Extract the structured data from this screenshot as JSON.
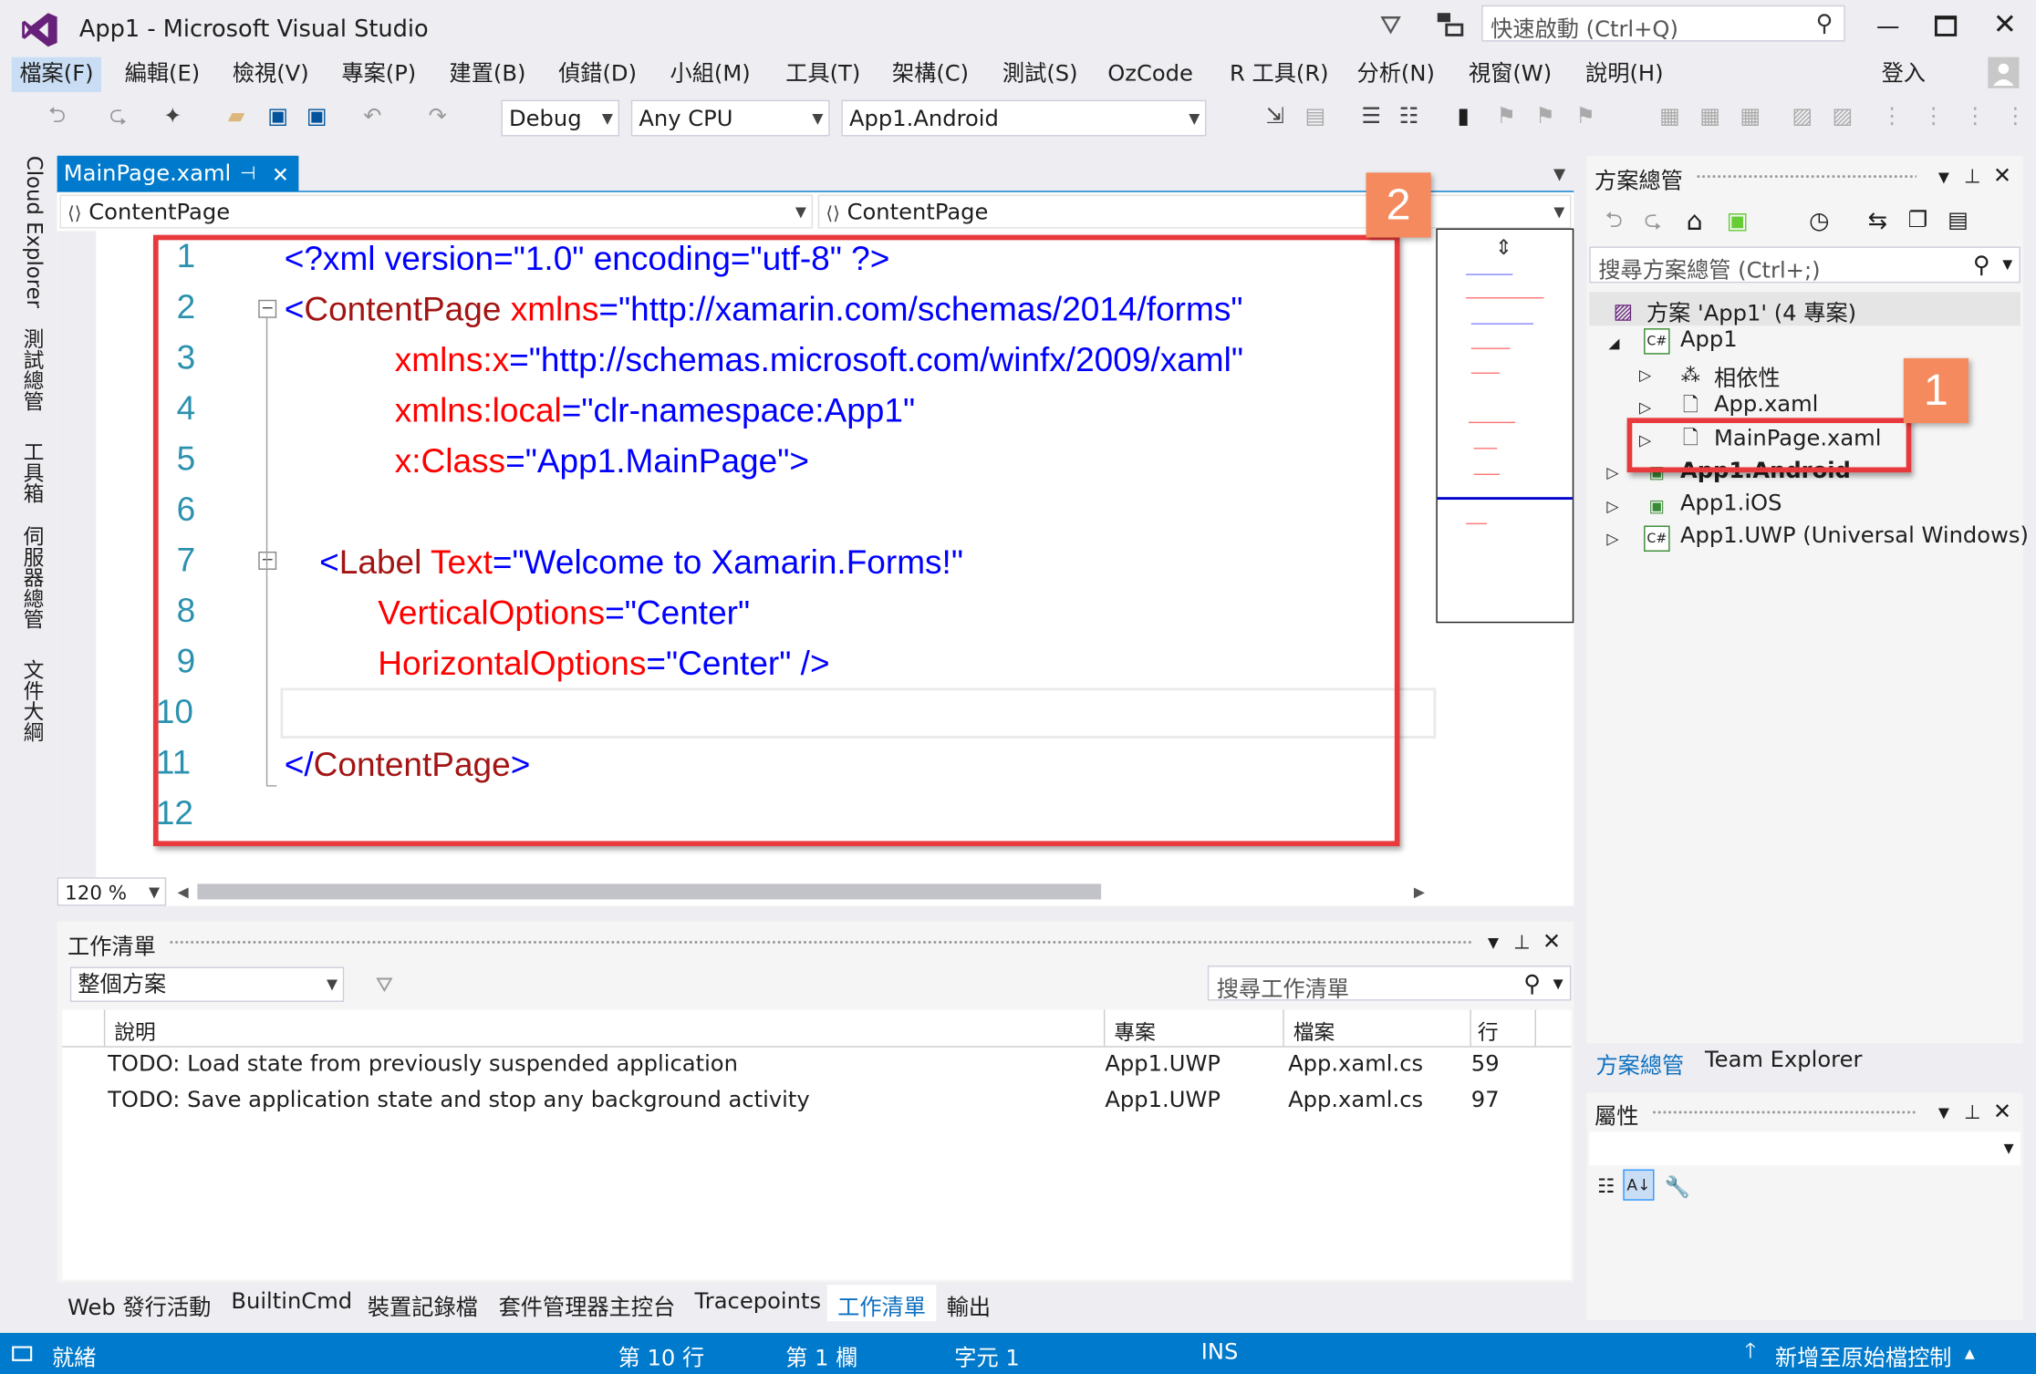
{
  "window": {
    "title": "App1 - Microsoft Visual Studio",
    "quick_launch_placeholder": "快速啟動 (Ctrl+Q)",
    "sign_in": "登入"
  },
  "menu": [
    "檔案(F)",
    "編輯(E)",
    "檢視(V)",
    "專案(P)",
    "建置(B)",
    "偵錯(D)",
    "小組(M)",
    "工具(T)",
    "架構(C)",
    "測試(S)",
    "OzCode",
    "R 工具(R)",
    "分析(N)",
    "視窗(W)",
    "說明(H)"
  ],
  "toolbar": {
    "config": "Debug",
    "platform": "Any CPU",
    "startup": "App1.Android"
  },
  "left_tabs": [
    "Cloud Explorer",
    "測試總管",
    "工具箱",
    "伺服器總管",
    "文件大綱"
  ],
  "editor": {
    "tab_title": "MainPage.xaml",
    "nav_left": "ContentPage",
    "nav_right": "ContentPage",
    "zoom": "120 %",
    "line_numbers": [
      "1",
      "2",
      "3",
      "4",
      "5",
      "6",
      "7",
      "8",
      "9",
      "10",
      "11",
      "12"
    ],
    "code": {
      "l1_a": "<?xml version=\"1.0\" encoding=\"utf-8\" ?>",
      "l2_a": "<ContentPage",
      "l2_b": " xmlns",
      "l2_c": "=\"http://xamarin.com/schemas/2014/forms\"",
      "l3_a": "xmlns:x",
      "l3_b": "=\"http://schemas.microsoft.com/winfx/2009/xaml\"",
      "l4_a": "xmlns:local",
      "l4_b": "=\"clr-namespace:App1\"",
      "l5_a": "x:Class",
      "l5_b": "=\"App1.MainPage\">",
      "l7_a": "<Label",
      "l7_b": " Text",
      "l7_c": "=\"Welcome to Xamarin.Forms!\"",
      "l8_a": "VerticalOptions",
      "l8_b": "=\"Center\"",
      "l9_a": "HorizontalOptions",
      "l9_b": "=\"Center\" />",
      "l11_a": "</ContentPage>"
    }
  },
  "callouts": {
    "one": "1",
    "two": "2"
  },
  "solution": {
    "title": "方案總管",
    "search_placeholder": "搜尋方案總管 (Ctrl+;)",
    "items": [
      {
        "label": "方案 'App1' (4 專案)"
      },
      {
        "label": "App1"
      },
      {
        "label": "相依性"
      },
      {
        "label": "App.xaml"
      },
      {
        "label": "MainPage.xaml"
      },
      {
        "label": "App1.Android"
      },
      {
        "label": "App1.iOS"
      },
      {
        "label": "App1.UWP (Universal Windows)"
      }
    ],
    "bottom_tabs": [
      "方案總管",
      "Team Explorer"
    ]
  },
  "properties": {
    "title": "屬性"
  },
  "tasklist": {
    "title": "工作清單",
    "scope": "整個方案",
    "search_placeholder": "搜尋工作清單",
    "columns": [
      "說明",
      "專案",
      "檔案",
      "行"
    ],
    "rows": [
      {
        "desc": "TODO: Load state from previously suspended application",
        "project": "App1.UWP",
        "file": "App.xaml.cs",
        "line": "59"
      },
      {
        "desc": "TODO: Save application state and stop any background activity",
        "project": "App1.UWP",
        "file": "App.xaml.cs",
        "line": "97"
      }
    ]
  },
  "bottom_tabs": [
    "Web 發行活動",
    "BuiltinCmd",
    "裝置記錄檔",
    "套件管理器主控台",
    "Tracepoints",
    "工作清單",
    "輸出"
  ],
  "status": {
    "ready": "就緒",
    "line": "第 10 行",
    "col": "第 1 欄",
    "char": "字元 1",
    "mode": "INS",
    "source_control": "新增至原始檔控制"
  },
  "colors": {
    "accent": "#007acc",
    "callout": "#f58a5e",
    "highlight_box": "#e8393c"
  }
}
